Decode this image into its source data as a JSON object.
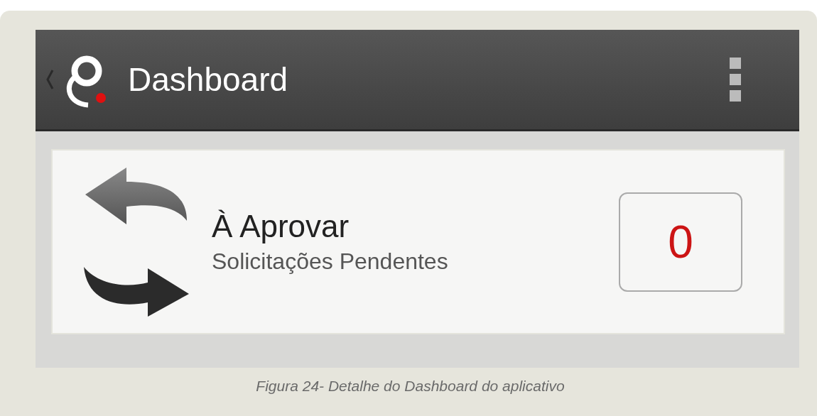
{
  "app_bar": {
    "title": "Dashboard"
  },
  "card": {
    "title": "À Aprovar",
    "subtitle": "Solicitações Pendentes",
    "count": "0"
  },
  "caption": "Figura 24- Detalhe do Dashboard do aplicativo"
}
